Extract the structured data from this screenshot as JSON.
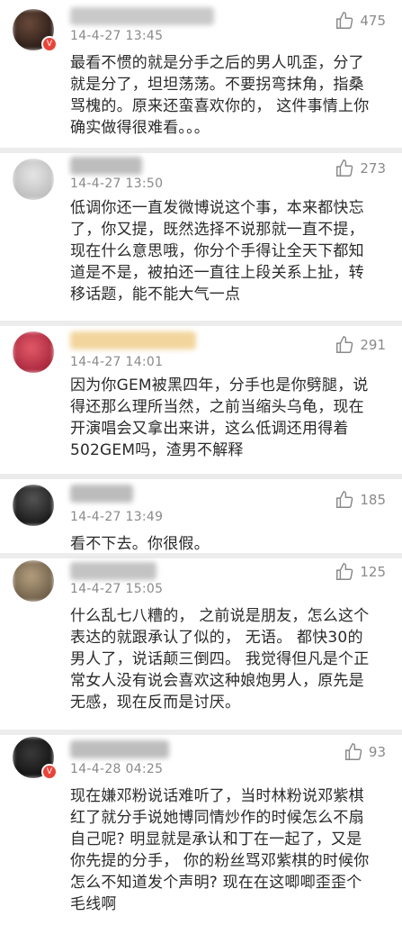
{
  "comments": [
    {
      "time": "14-4-27 13:45",
      "likes": "475",
      "text": "最看不惯的就是分手之后的男人叽歪，分了\n就是分了，坦坦荡荡。不要拐弯抹角，指桑\n骂槐的。原来还蛮喜欢你的，  这件事情上你\n确实做得很难看。。。"
    },
    {
      "time": "14-4-27 13:50",
      "likes": "273",
      "text": "低调你还一直发微博说这个事，本来都快忘\n了，你又提，既然选择不说那就一直不提，\n现在什么意思哦，你分个手得让全天下都知\n道是不是，被拍还一直往上段关系上扯，转\n移话题，能不能大气一点"
    },
    {
      "time": "14-4-27 14:01",
      "likes": "291",
      "text": "因为你GEM被黑四年，分手也是你劈腿，说\n得还那么理所当然，之前当缩头乌龟，现在\n开演唱会又拿出来讲，这么低调还用得着\n502GEM吗，渣男不解释"
    },
    {
      "time": "14-4-27 13:49",
      "likes": "185",
      "text": "看不下去。你很假。"
    },
    {
      "time": "14-4-27 15:05",
      "likes": "125",
      "text": "什么乱七八糟的，  之前说是朋友，怎么这个\n表达的就跟承认了似的，  无语。  都快30的\n男人了，说话颠三倒四。  我觉得但凡是个正\n常女人没有说会喜欢这种娘炮男人，原先是\n无感，现在反而是讨厌。"
    },
    {
      "time": "14-4-28 04:25",
      "likes": "93",
      "text": "现在嫌邓粉说话难听了，当时林粉说邓紫棋\n红了就分手说她博同情炒作的时候怎么不扇\n自己呢?  明显就是承认和丁在一起了，又是\n你先提的分手，  你的粉丝骂邓紫棋的时候你\n怎么不知道发个声明?  现在在这唧唧歪歪个\n毛线啊"
    }
  ],
  "icons": {
    "like": "thumbs-up-icon",
    "verified": "verified-badge-icon"
  },
  "badge_glyph": "V"
}
